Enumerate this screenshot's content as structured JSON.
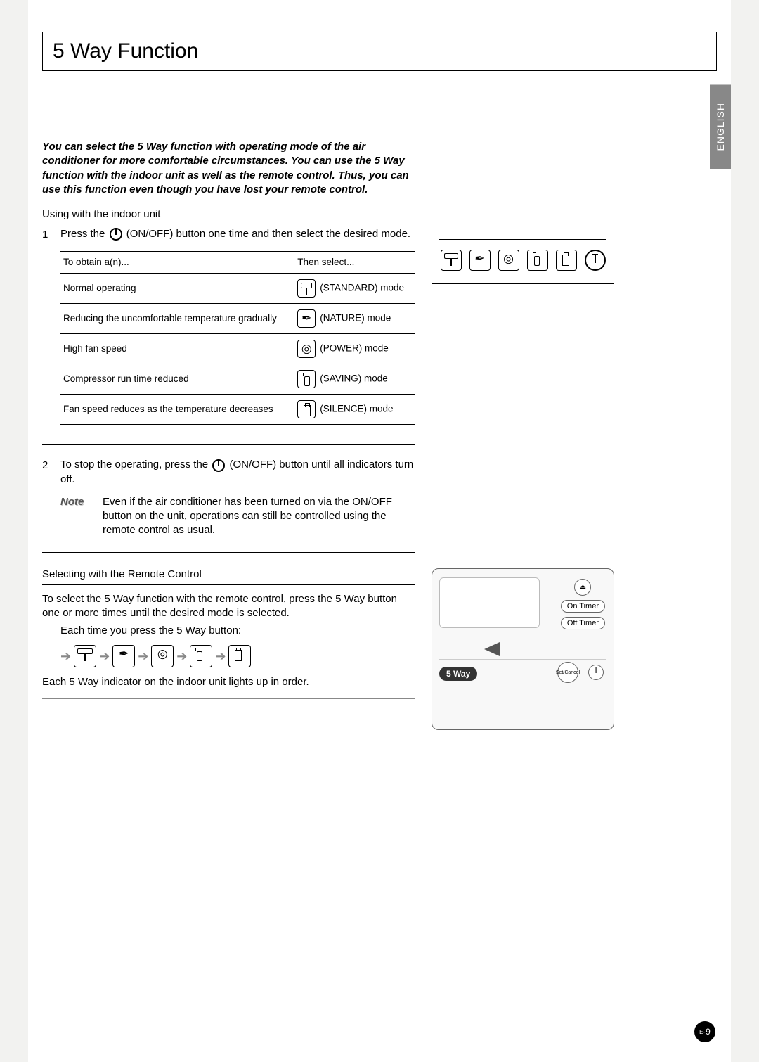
{
  "header": {
    "title": "5 Way Function"
  },
  "language_tab": "ENGLISH",
  "intro": "You can select the 5 Way function with operating mode of the air conditioner for more comfortable circumstances. You can use the 5 Way function with the indoor unit as well as the remote control. Thus, you can use this function even though you have lost your remote control.",
  "section1": {
    "title": "Using with the indoor unit",
    "step1_pre": "Press the ",
    "step1_post": " (ON/OFF) button one time and then select the desired mode.",
    "table": {
      "col1": "To obtain a(n)...",
      "col2": "Then select...",
      "rows": [
        {
          "desc": "Normal operating",
          "mode": "(STANDARD) mode"
        },
        {
          "desc": "Reducing the uncomfortable temperature gradually",
          "mode": "(NATURE) mode"
        },
        {
          "desc": "High fan speed",
          "mode": "(POWER) mode"
        },
        {
          "desc": "Compressor run time reduced",
          "mode": "(SAVING) mode"
        },
        {
          "desc": "Fan speed reduces as the temperature decreases",
          "mode": "(SILENCE) mode"
        }
      ]
    },
    "step2_pre": "To stop the operating, press the ",
    "step2_post": " (ON/OFF) button until all indicators turn off.",
    "note_label": "Note",
    "note_body": "Even if the air conditioner has been turned on via the ON/OFF button on the unit, operations can still be controlled using the remote control as usual."
  },
  "section2": {
    "title": "Selecting with the Remote Control",
    "body": "To select the 5 Way function with the remote control, press the 5 Way button one or more times until the desired mode is selected.",
    "subtitle": "Each time you press the 5 Way button:",
    "footer": "Each 5 Way indicator on the indoor unit lights up in order."
  },
  "remote": {
    "on_timer": "On Timer",
    "off_timer": "Off Timer",
    "five_way": "5 Way",
    "set_cancel": "Set/Cancel"
  },
  "page_number": {
    "prefix": "E-",
    "num": "9"
  }
}
